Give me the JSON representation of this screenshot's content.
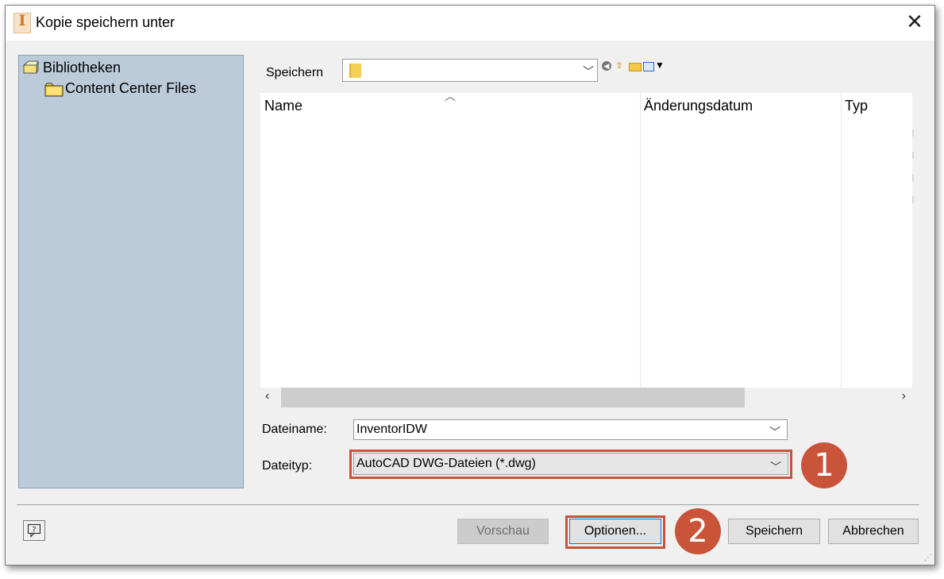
{
  "window": {
    "title": "Kopie speichern unter",
    "app_icon_letter": "I",
    "close_glyph": "✕"
  },
  "places": [
    {
      "label": "Bibliotheken",
      "icon": "libraries-icon"
    },
    {
      "label": "Content Center Files",
      "icon": "folder-icon"
    }
  ],
  "location": {
    "label": "Speichern",
    "value": ""
  },
  "filelist": {
    "columns": [
      "Name",
      "Änderungsdatum",
      "Typ"
    ],
    "items": []
  },
  "filename": {
    "label": "Dateiname:",
    "value": "InventorIDW"
  },
  "filetype": {
    "label": "Dateityp:",
    "value": "AutoCAD DWG-Dateien (*.dwg)"
  },
  "callouts": [
    "1",
    "2"
  ],
  "buttons": {
    "preview": "Vorschau",
    "options": "Optionen...",
    "save": "Speichern",
    "cancel": "Abbrechen"
  },
  "colors": {
    "accent_callout": "#c9543a",
    "places_background": "#bccbda",
    "dialog_background": "#f0f0f0"
  }
}
